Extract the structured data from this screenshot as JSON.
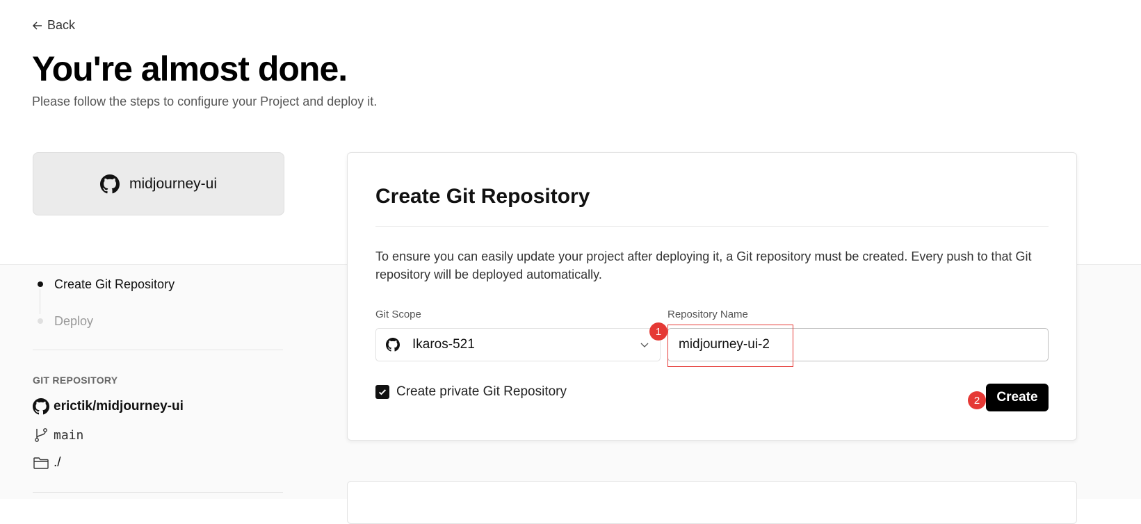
{
  "nav": {
    "back_label": "Back"
  },
  "header": {
    "title": "You're almost done.",
    "subtitle": "Please follow the steps to configure your Project and deploy it."
  },
  "repo_card": {
    "name": "midjourney-ui",
    "icon": "github-icon"
  },
  "steps": [
    {
      "label": "Create Git Repository",
      "active": true
    },
    {
      "label": "Deploy",
      "active": false
    }
  ],
  "git_repository": {
    "section_label": "GIT REPOSITORY",
    "repo": "erictik/midjourney-ui",
    "branch": "main",
    "root_directory": "./"
  },
  "panel": {
    "title": "Create Git Repository",
    "description": "To ensure you can easily update your project after deploying it, a Git repository must be created. Every push to that Git repository will be deployed automatically.",
    "git_scope": {
      "label": "Git Scope",
      "value": "Ikaros-521"
    },
    "repository_name": {
      "label": "Repository Name",
      "value": "midjourney-ui-2"
    },
    "private_checkbox": {
      "label": "Create private Git Repository",
      "checked": true
    },
    "create_button_label": "Create"
  },
  "annotations": {
    "badge_1": "1",
    "badge_2": "2"
  },
  "colors": {
    "accent": "#000000",
    "annotation": "#e53935",
    "lower_bg": "#fafafa"
  }
}
